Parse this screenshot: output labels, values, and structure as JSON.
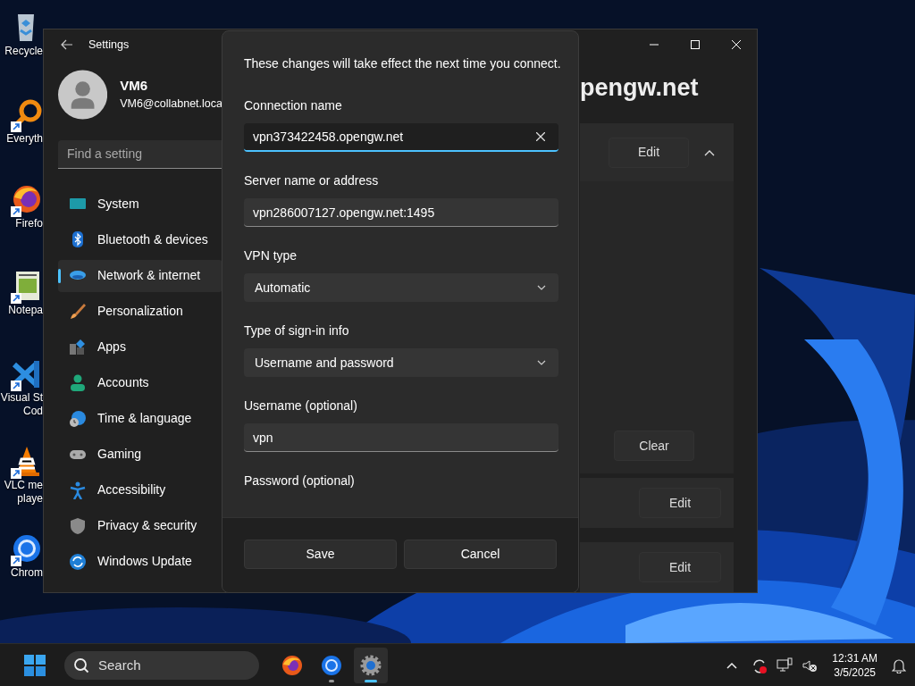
{
  "desktop_icons": [
    {
      "kind": "recycle-bin",
      "lines": [
        "Recycle"
      ],
      "shortcut": false
    },
    {
      "kind": "search-app",
      "lines": [
        "Everyth"
      ],
      "shortcut": true
    },
    {
      "kind": "firefox",
      "lines": [
        "Firefo"
      ],
      "shortcut": true
    },
    {
      "kind": "notepad",
      "lines": [
        "Notepa"
      ],
      "shortcut": true
    },
    {
      "kind": "vscode",
      "lines": [
        "Visual St",
        "Cod"
      ],
      "shortcut": true
    },
    {
      "kind": "vlc",
      "lines": [
        "VLC me",
        "playe"
      ],
      "shortcut": true
    },
    {
      "kind": "chrome",
      "lines": [
        "Chrom"
      ],
      "shortcut": true
    }
  ],
  "settings": {
    "title": "Settings",
    "user": {
      "name": "VM6",
      "email": "VM6@collabnet.loca"
    },
    "search": {
      "placeholder": "Find a setting"
    },
    "nav": [
      {
        "kind": "system",
        "label": "System",
        "selected": false
      },
      {
        "kind": "bluetooth",
        "label": "Bluetooth & devices",
        "selected": false
      },
      {
        "kind": "network",
        "label": "Network & internet",
        "selected": true
      },
      {
        "kind": "personalization",
        "label": "Personalization",
        "selected": false
      },
      {
        "kind": "apps",
        "label": "Apps",
        "selected": false
      },
      {
        "kind": "accounts",
        "label": "Accounts",
        "selected": false
      },
      {
        "kind": "time",
        "label": "Time & language",
        "selected": false
      },
      {
        "kind": "gaming",
        "label": "Gaming",
        "selected": false
      },
      {
        "kind": "accessibility",
        "label": "Accessibility",
        "selected": false
      },
      {
        "kind": "privacy",
        "label": "Privacy & security",
        "selected": false
      },
      {
        "kind": "update",
        "label": "Windows Update",
        "selected": false
      }
    ],
    "page_title": "pengw.net",
    "panels": [
      {
        "kind": "header",
        "button": "Edit",
        "expanded": true
      },
      {
        "kind": "expanded",
        "button": "Clear"
      },
      {
        "kind": "row",
        "button": "Edit"
      },
      {
        "kind": "row",
        "button": "Edit"
      }
    ]
  },
  "dialog": {
    "notice": "These changes will take effect the next time you connect.",
    "fields": [
      {
        "kind": "text",
        "label": "Connection name",
        "value": "vpn373422458.opengw.net",
        "focused": true
      },
      {
        "kind": "text",
        "label": "Server name or address",
        "value": "vpn286007127.opengw.net:1495",
        "focused": false
      },
      {
        "kind": "dropdown",
        "label": "VPN type",
        "value": "Automatic"
      },
      {
        "kind": "dropdown",
        "label": "Type of sign-in info",
        "value": "Username and password"
      },
      {
        "kind": "text",
        "label": "Username (optional)",
        "value": "vpn",
        "focused": false
      },
      {
        "kind": "label",
        "label": "Password (optional)"
      }
    ],
    "buttons": [
      "Save",
      "Cancel"
    ]
  },
  "taskbar": {
    "search": {
      "placeholder": "Search"
    },
    "apps": [
      {
        "kind": "firefox",
        "active": false,
        "running": false
      },
      {
        "kind": "chrome",
        "active": false,
        "running": true
      },
      {
        "kind": "settings",
        "active": true,
        "running": true
      }
    ],
    "time": "12:31 AM",
    "date": "3/5/2025"
  }
}
